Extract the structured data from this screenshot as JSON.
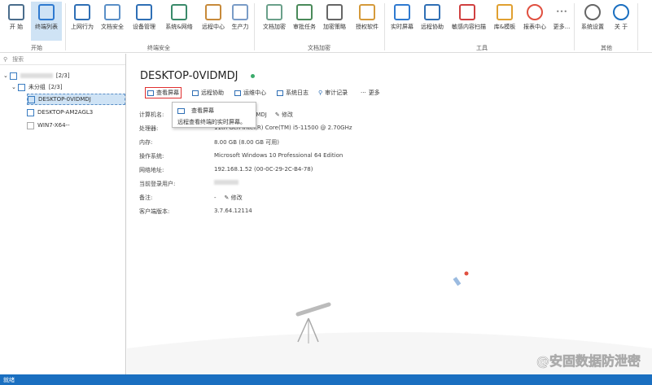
{
  "ribbon": {
    "items": [
      {
        "label": "开 始",
        "icon": "home-icon"
      },
      {
        "label": "终端列表",
        "icon": "terminal-list-icon"
      },
      {
        "label": "上网行为",
        "icon": "web-behavior-icon"
      },
      {
        "label": "文档安全",
        "icon": "doc-security-icon"
      },
      {
        "label": "设备管理",
        "icon": "device-manage-icon"
      },
      {
        "label": "系统&网络",
        "icon": "system-network-icon"
      },
      {
        "label": "远程中心",
        "icon": "remote-center-icon"
      },
      {
        "label": "生产力",
        "icon": "productivity-icon"
      },
      {
        "label": "文档加密",
        "icon": "doc-encrypt-icon"
      },
      {
        "label": "审批任务",
        "icon": "approval-icon"
      },
      {
        "label": "加密策略",
        "icon": "encrypt-policy-icon"
      },
      {
        "label": "授权软件",
        "icon": "authorized-software-icon"
      },
      {
        "label": "实时屏幕",
        "icon": "realtime-screen-icon"
      },
      {
        "label": "远程协助",
        "icon": "remote-assist-icon"
      },
      {
        "label": "敏感内容扫描",
        "icon": "sensitive-scan-icon"
      },
      {
        "label": "库&模板",
        "icon": "library-template-icon"
      },
      {
        "label": "报表中心",
        "icon": "report-center-icon"
      },
      {
        "label": "更多...",
        "icon": "more-icon"
      },
      {
        "label": "系统设置",
        "icon": "gear-icon"
      },
      {
        "label": "关 于",
        "icon": "info-icon"
      }
    ],
    "groups": [
      "开始",
      "终端安全",
      "文档加密",
      "工具",
      "其他"
    ]
  },
  "sidebar": {
    "search_placeholder": "搜索",
    "root_count": "[2/3]",
    "group_label": "未分组",
    "group_count": "[2/3]",
    "devices": [
      "DESKTOP-0VIDMDJ",
      "DESKTOP-AM2AGL3",
      "WIN7-X64--"
    ]
  },
  "main": {
    "title": "DESKTOP-0VIDMDJ",
    "actions": [
      "查看屏幕",
      "远程协助",
      "运维中心",
      "系统日志",
      "审计记录",
      "更多"
    ],
    "tooltip": {
      "title": "查看屏幕",
      "desc": "远程查看终端的实时屏幕。"
    },
    "fields": [
      {
        "label": "计算机名:",
        "value": "DESKTOP-0VIDMDJ"
      },
      {
        "label": "处理器:",
        "value": "11th Gen Intel(R) Core(TM) i5-11500 @ 2.70GHz"
      },
      {
        "label": "内存:",
        "value": "8.00 GB (8.00 GB 可用)"
      },
      {
        "label": "操作系统:",
        "value": "Microsoft Windows 10 Professional 64 Edition"
      },
      {
        "label": "网络地址:",
        "value": "192.168.1.52  (00-0C-29-2C-B4-78)"
      },
      {
        "label": "当前登录用户:",
        "value": ""
      },
      {
        "label": "备注:",
        "value": "-"
      },
      {
        "label": "客户端版本:",
        "value": "3.7.64.12114"
      }
    ],
    "edit_label": "修改"
  },
  "watermark": "@安固数据防泄密",
  "status": "就绪",
  "colors": {
    "accent": "#1a6fc0",
    "highlight": "#cfe3f5",
    "red": "#e03030"
  }
}
